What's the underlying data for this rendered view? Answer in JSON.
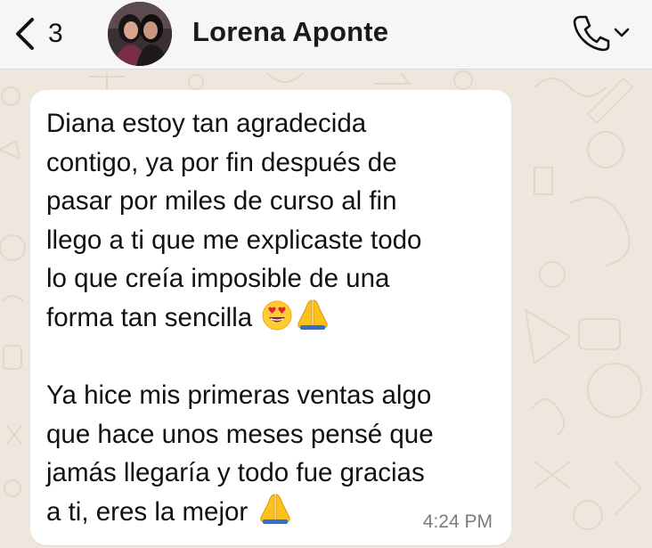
{
  "header": {
    "back_label": "back",
    "unread_count": "3",
    "contact_name": "Lorena Aponte",
    "call_icon": "phone-icon",
    "dropdown_icon": "chevron-down-icon"
  },
  "message": {
    "paragraph1_lines": [
      "Diana estoy tan agradecida",
      "contigo, ya por fin después de",
      "pasar por miles de curso al fin",
      "llego a ti que me explicaste todo",
      "lo que creía imposible de una",
      "forma tan sencilla"
    ],
    "paragraph2_lines": [
      "Ya hice mis primeras ventas algo",
      "que hace unos meses pensé que",
      "jamás llegaría y todo fue gracias",
      "a ti, eres la mejor"
    ],
    "emoji_1": "😍",
    "emoji_2": "🙏",
    "emoji_3": "🙏",
    "timestamp": "4:24 PM"
  },
  "colors": {
    "header_bg": "#f6f6f6",
    "wallpaper_bg": "#efe7de",
    "bubble_bg": "#ffffff",
    "timestamp": "#7b7b7b"
  }
}
